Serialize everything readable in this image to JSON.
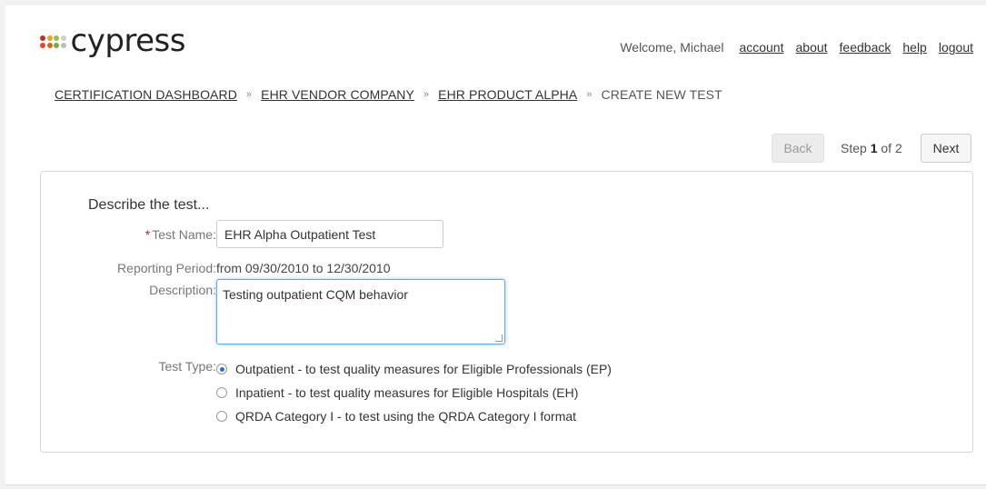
{
  "app": {
    "name": "cypress",
    "logo_dot_colors": [
      "#c0392b",
      "#e6a23c",
      "#8dc63f",
      "#cccccc",
      "#e74c3c",
      "#d35400",
      "#6ab04c",
      "#bbbbbb"
    ]
  },
  "topnav": {
    "welcome": "Welcome, Michael",
    "links": [
      "account",
      "about",
      "feedback",
      "help",
      "logout"
    ]
  },
  "breadcrumb": {
    "items": [
      "CERTIFICATION DASHBOARD",
      "EHR VENDOR COMPANY",
      "EHR PRODUCT ALPHA"
    ],
    "current": "CREATE NEW TEST",
    "separator": "»"
  },
  "wizard": {
    "back_label": "Back",
    "next_label": "Next",
    "step_prefix": "Step",
    "step_current": "1",
    "step_suffix": "of 2"
  },
  "form": {
    "section_title": "Describe the test...",
    "required_mark": "*",
    "test_name_label": "Test Name:",
    "test_name_value": "EHR Alpha Outpatient Test",
    "reporting_period_label": "Reporting Period:",
    "reporting_period_value": "from 09/30/2010 to 12/30/2010",
    "description_label": "Description:",
    "description_value": "Testing outpatient CQM behavior",
    "test_type_label": "Test Type:",
    "test_types": [
      {
        "label": "Outpatient - to test quality measures for Eligible Professionals (EP)",
        "checked": true
      },
      {
        "label": "Inpatient - to test quality measures for Eligible Hospitals (EH)",
        "checked": false
      },
      {
        "label": "QRDA Category I - to test using the QRDA Category I format",
        "checked": false
      }
    ]
  }
}
